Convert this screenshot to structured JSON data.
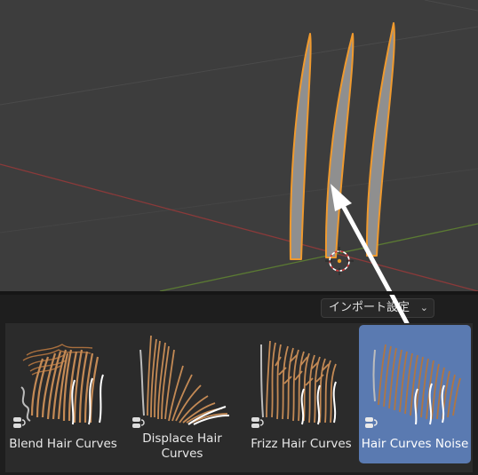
{
  "import_settings": {
    "label": "インポート設定",
    "chevron": "chevron-down-icon"
  },
  "assets": [
    {
      "name": "Blend Hair Curves",
      "selected": false
    },
    {
      "name": "Displace Hair Curves",
      "selected": false
    },
    {
      "name": "Frizz Hair Curves",
      "selected": false
    },
    {
      "name": "Hair Curves Noise",
      "selected": true
    }
  ],
  "colors": {
    "viewport_bg": "#3d3d3d",
    "selection_outline": "#f09a2e",
    "selected_asset_bg": "#5a7ab1",
    "x_axis": "#8a3a3a",
    "y_axis": "#5b7a33",
    "hair": "#c48a55"
  }
}
